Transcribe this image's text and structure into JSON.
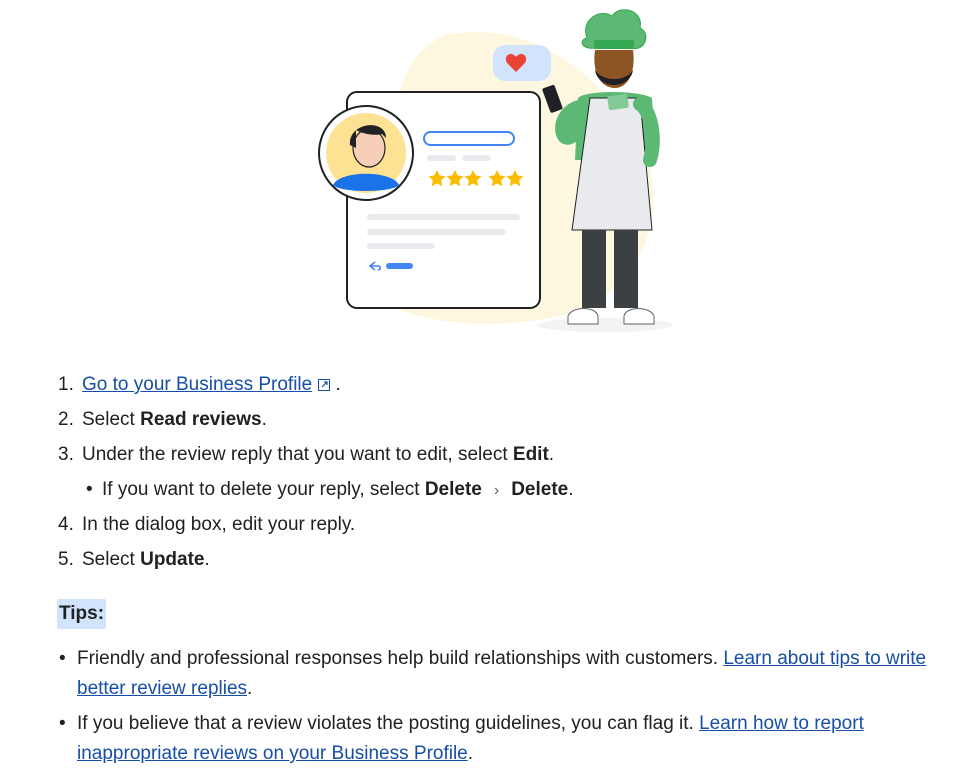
{
  "steps": [
    {
      "num": "1.",
      "link": "Go to your Business Profile",
      "after": "."
    },
    {
      "num": "2.",
      "pre": "Select ",
      "bold": "Read reviews",
      "after": "."
    },
    {
      "num": "3.",
      "pre": "Under the review reply that you want to edit, select ",
      "bold": "Edit",
      "after": "."
    },
    {
      "num": "4.",
      "text": "In the dialog box, edit your reply."
    },
    {
      "num": "5.",
      "pre": "Select ",
      "bold": "Update",
      "after": "."
    }
  ],
  "substep": {
    "pre": "If you want to delete your reply, select ",
    "bold1": "Delete",
    "bold2": "Delete",
    "after": "."
  },
  "tips": {
    "label": "Tips:",
    "items": [
      {
        "text": "Friendly and professional responses help build relationships with customers. ",
        "link": "Learn about tips to write better review replies",
        "after": "."
      },
      {
        "text": "If you believe that a review violates the posting guidelines, you can flag it. ",
        "link": "Learn how to report inappropriate reviews on your Business Profile",
        "after": "."
      }
    ]
  },
  "illustration": {
    "rating_stars": 5,
    "colors": {
      "accent_blue": "#4285f4",
      "star": "#fbbc04",
      "chef_green": "#5bb974",
      "blob": "#fef7e0",
      "heart": "#ea4335"
    }
  }
}
